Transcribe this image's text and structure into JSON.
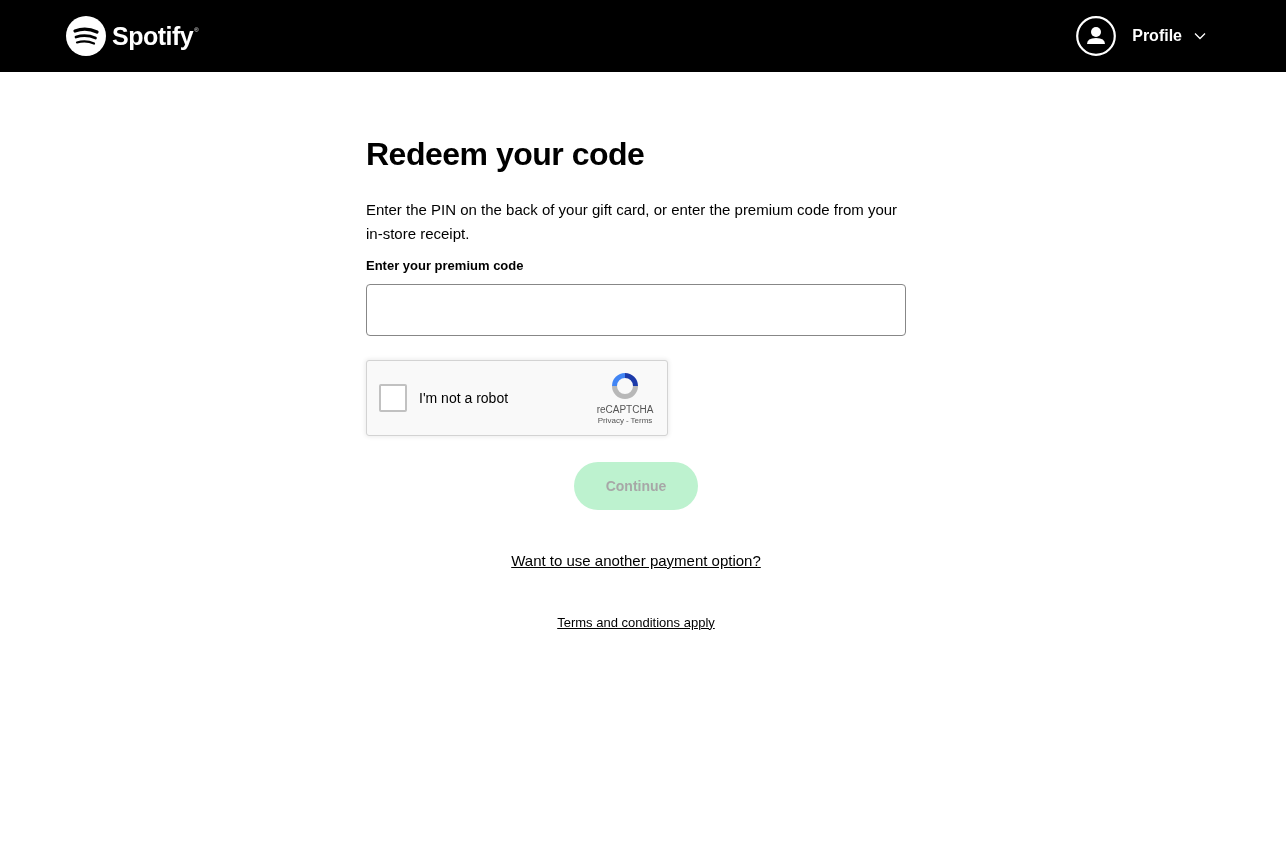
{
  "header": {
    "logo_text": "Spotify",
    "logo_mark": "®",
    "profile_label": "Profile"
  },
  "form": {
    "title": "Redeem your code",
    "description": "Enter the PIN on the back of your gift card, or enter the premium code from your in-store receipt.",
    "field_label": "Enter your premium code",
    "captcha": {
      "label": "I'm not a robot",
      "checked": false,
      "brand": "reCAPTCHA",
      "privacy": "Privacy",
      "separator": "-",
      "terms": "Terms"
    },
    "continue_button": {
      "label": "Continue",
      "disabled": true
    },
    "links": [
      "Want to use another payment option?",
      "Terms and conditions apply"
    ]
  }
}
